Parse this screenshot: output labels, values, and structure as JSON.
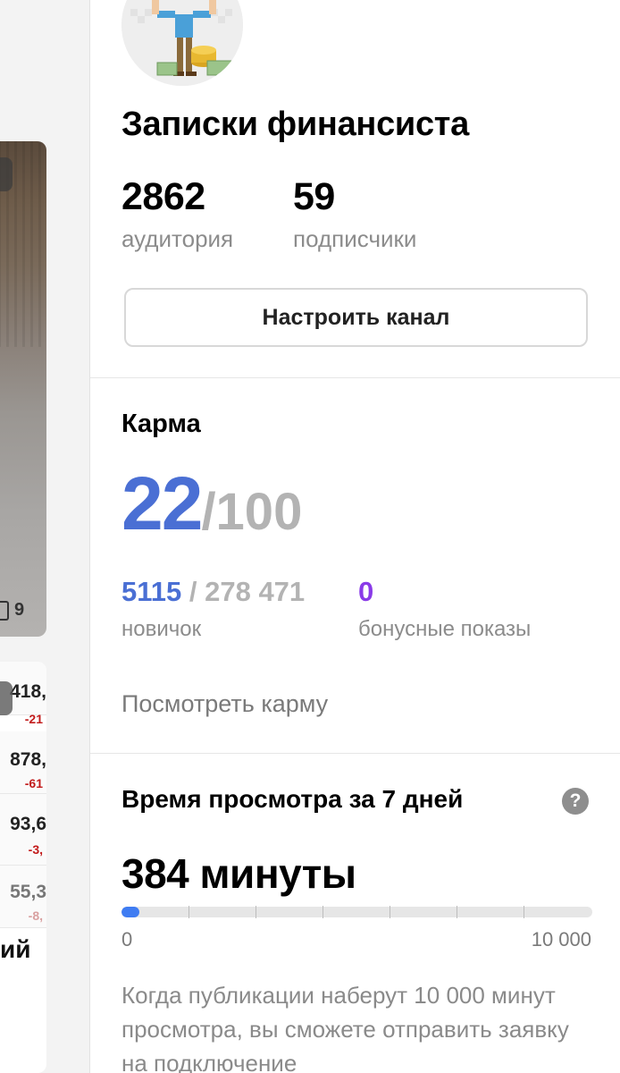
{
  "left_feed": {
    "card1_more": "•••",
    "card1_comments": "9",
    "card2_more": "•••",
    "quotes": [
      {
        "value": "418,",
        "change": "-21"
      },
      {
        "value": "878,",
        "change": "-61"
      },
      {
        "value": "93,6",
        "change": "-3,"
      },
      {
        "value": "55,3",
        "change": "-8,"
      }
    ],
    "partial_title": "ий"
  },
  "channel": {
    "name": "Записки финансиста",
    "audience_value": "2862",
    "audience_label": "аудитория",
    "subscribers_value": "59",
    "subscribers_label": "подписчики",
    "setup_button": "Настроить канал"
  },
  "karma": {
    "title": "Карма",
    "value": "22",
    "max": "/100",
    "current": "5115",
    "separator": " / ",
    "total": "278 471",
    "level_label": "новичок",
    "bonus_value": "0",
    "bonus_label": "бонусные показы",
    "link": "Посмотреть карму"
  },
  "watch_time": {
    "title": "Время просмотра за 7 дней",
    "help": "?",
    "value": "384 минуты",
    "progress_min": "0",
    "progress_max": "10 000",
    "progress_fraction": 0.0384,
    "info": "Когда публикации наберут 10 000 минут просмотра, вы сможете отправить заявку на подключение"
  },
  "colors": {
    "accent_blue": "#4a6fd4",
    "bonus_purple": "#8a3be8",
    "progress_blue": "#3f7cf2"
  }
}
